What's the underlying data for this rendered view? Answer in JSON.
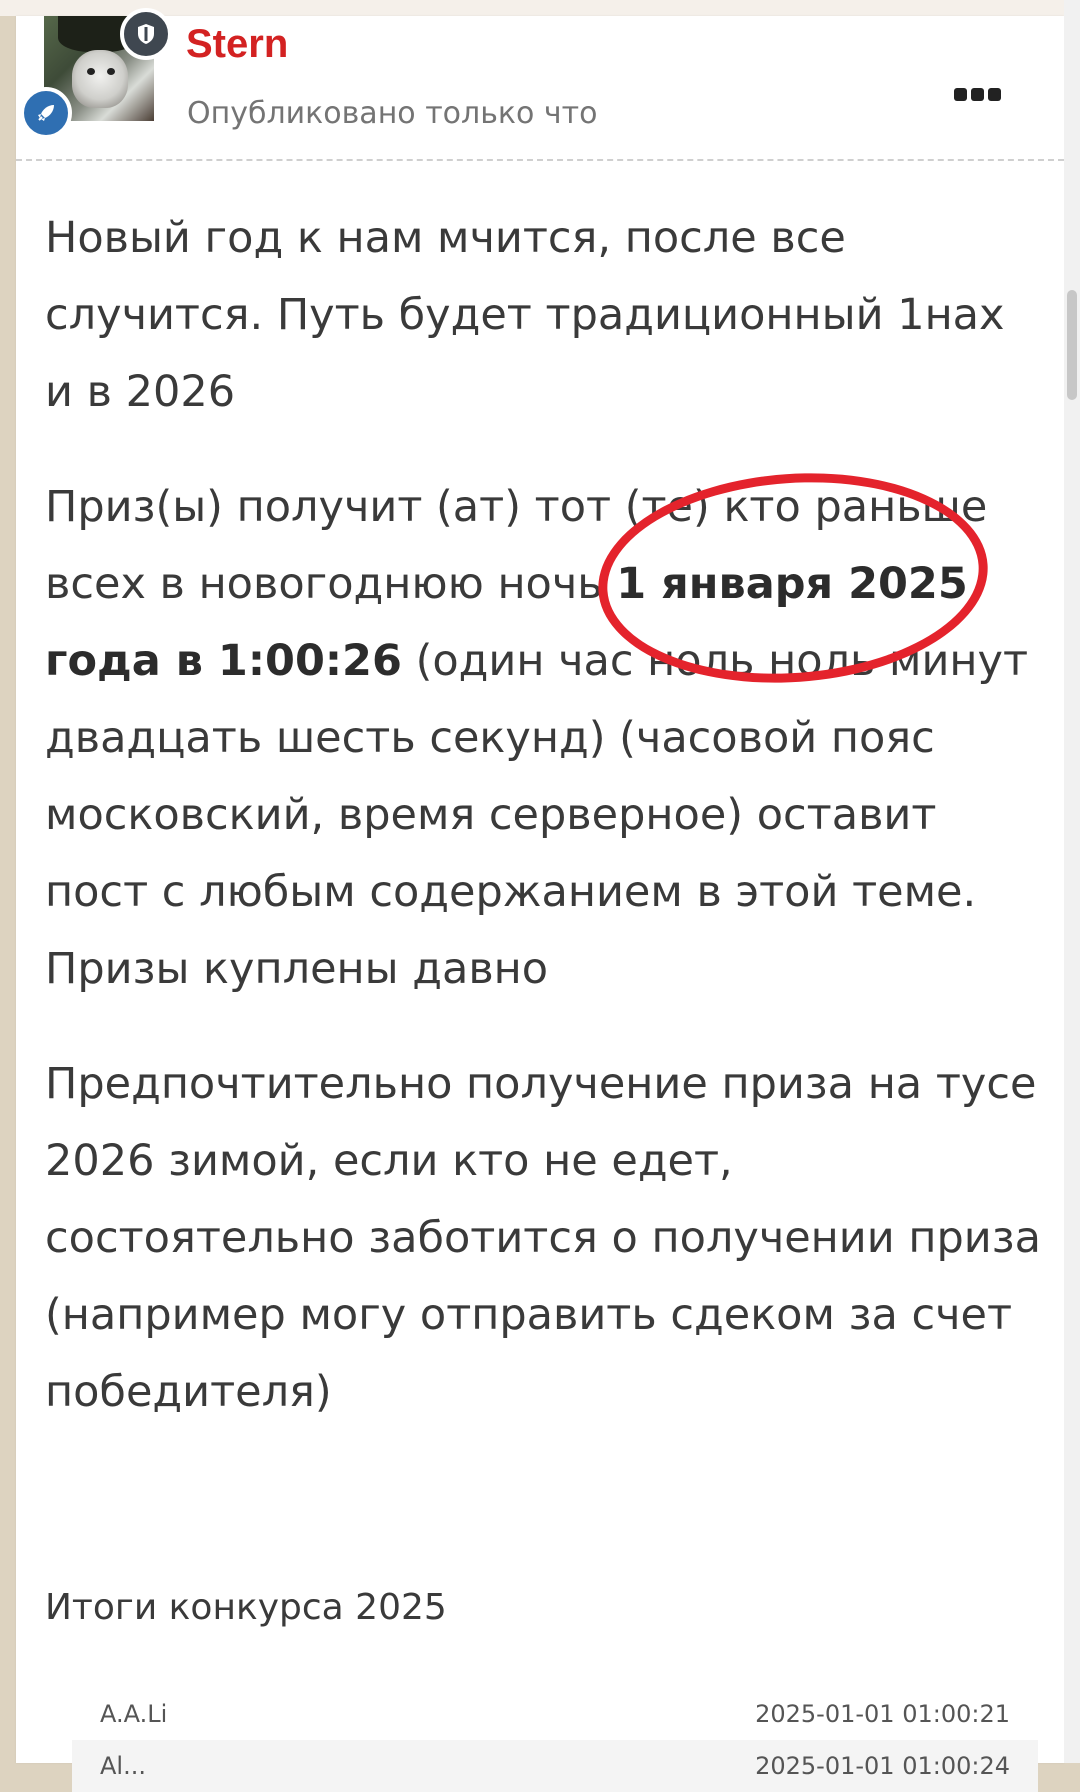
{
  "post": {
    "author": "Stern",
    "timestamp": "Опубликовано только что",
    "paragraphs": {
      "p1": "Новый год к нам мчится, после все случится. Путь будет традиционный 1нах и в 2026",
      "p2_before": "Приз(ы) получит (ат) тот (те) кто раньше всех в новогоднюю ночь ",
      "p2_bold": "1 января 2025 года в 1:00:26",
      "p2_after": " (один час ноль ноль минут двадцать шесть секунд)  (часовой пояс московский, время серверное)  оставит пост с любым содержанием в этой теме. Призы куплены давно",
      "p3": "Предпочтительно получение приза на тусе 2026 зимой, если кто не едет, состоятельно заботится о получении приза (например могу отправить сдеком за счет победителя)"
    }
  },
  "results": {
    "title": "Итоги конкурса 2025",
    "rows": [
      {
        "name": "A.A.Li",
        "time": "2025-01-01 01:00:21"
      },
      {
        "name": "Al...",
        "time": "2025-01-01 01:00:24"
      }
    ]
  },
  "icons": {
    "shield_badge": "shield-icon",
    "rocket_badge": "rocket-icon",
    "more": "more-icon"
  },
  "colors": {
    "author": "#d32222",
    "highlight": "#e4232c",
    "badge_blue": "#2f6fb2"
  }
}
